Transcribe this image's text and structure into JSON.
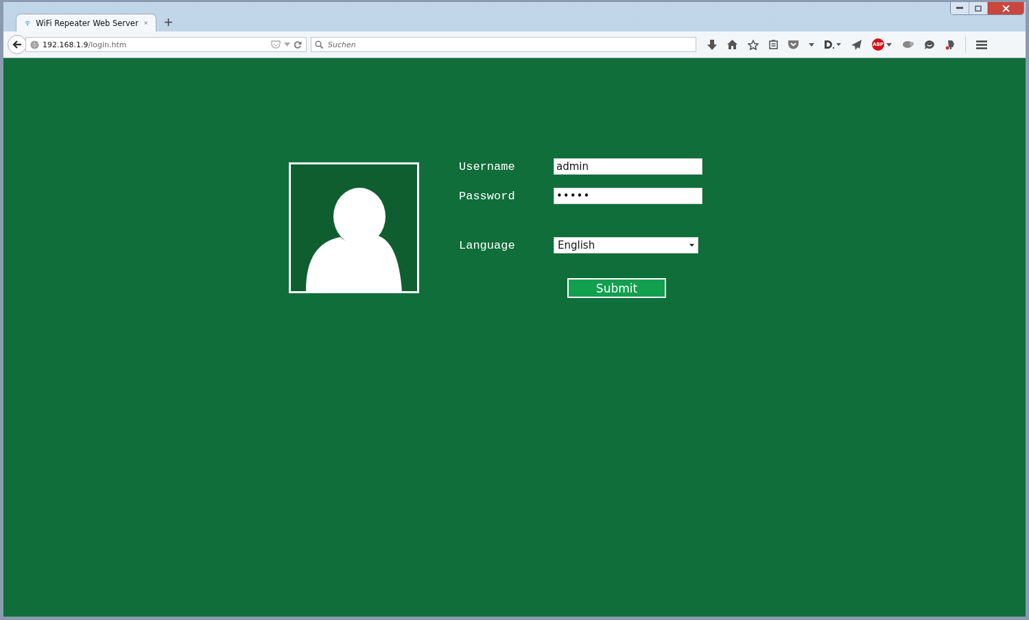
{
  "browser": {
    "tab": {
      "title": "WiFi Repeater Web Server",
      "selected": true
    },
    "url": {
      "host": "192.168.1.9",
      "path": "/login.htm"
    },
    "search": {
      "placeholder": "Suchen"
    },
    "abp_badge": "ABP"
  },
  "login": {
    "fields": [
      {
        "kind": "text",
        "label": "Username",
        "value": "admin"
      },
      {
        "kind": "password",
        "label": "Password",
        "value": "•••••"
      },
      {
        "kind": "select",
        "label": "Language",
        "value": "English"
      }
    ],
    "submit": "Submit"
  }
}
